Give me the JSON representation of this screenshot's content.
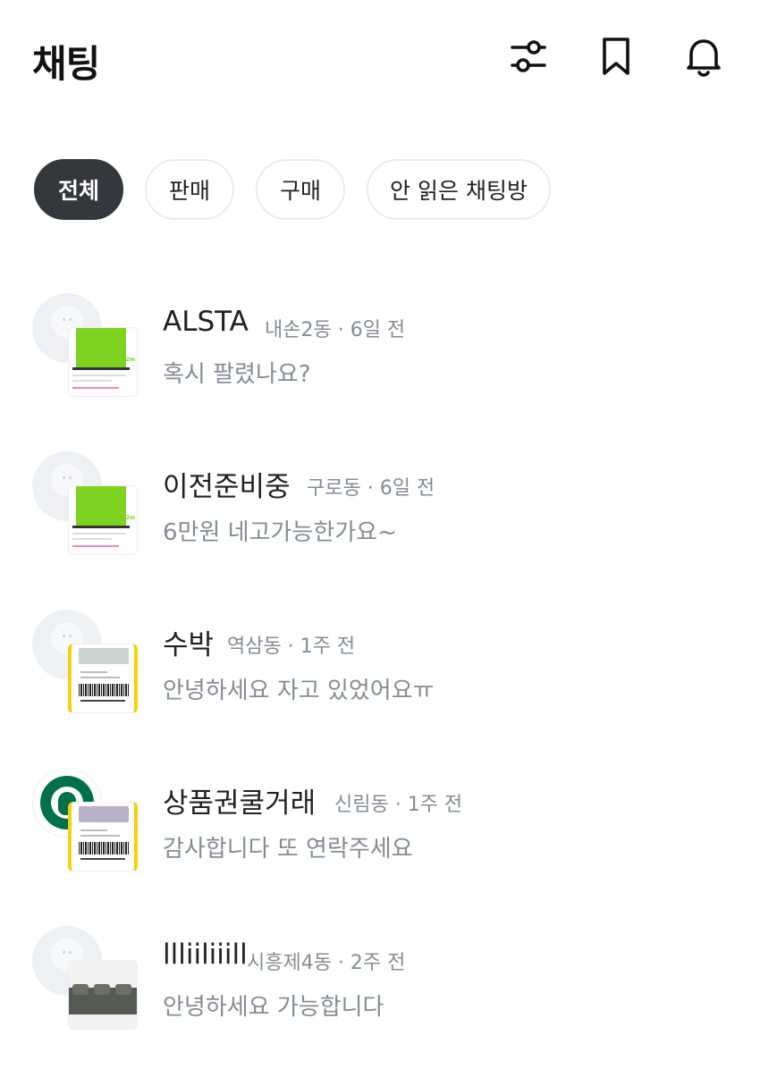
{
  "header": {
    "title": "채팅",
    "icons": [
      "filter-sliders-icon",
      "bookmark-icon",
      "bell-icon"
    ]
  },
  "filters": [
    {
      "label": "전체",
      "active": true
    },
    {
      "label": "판매",
      "active": false
    },
    {
      "label": "구매",
      "active": false
    },
    {
      "label": "안 읽은 채팅방",
      "active": false
    }
  ],
  "chats": [
    {
      "name": "ALSTA",
      "meta": "내손2동 · 6일 전",
      "message": "혹시 팔렸나요?",
      "thumb": "green-screen-product"
    },
    {
      "name": "이전준비중",
      "meta": "구로동 · 6일 전",
      "message": "6만원 네고가능한가요~",
      "thumb": "green-screen-product"
    },
    {
      "name": "수박",
      "meta": "역삼동 · 1주 전",
      "message": "안녕하세요 자고 있었어요ㅠ",
      "thumb": "gift-card-product"
    },
    {
      "name": "상품권쿨거래",
      "meta": "신림동 · 1주 전",
      "message": "감사합니다 또 연락주세요",
      "thumb": "gift-card-product"
    },
    {
      "name": "llliiliiill",
      "meta": "시흥제4동 · 2주 전",
      "message": "안녕하세요 가능합니다",
      "thumb": "sofa-product"
    }
  ],
  "colors": {
    "text": "#212124",
    "muted": "#868b94",
    "chip_active": "#34373b",
    "chip_border": "#eaebee"
  }
}
